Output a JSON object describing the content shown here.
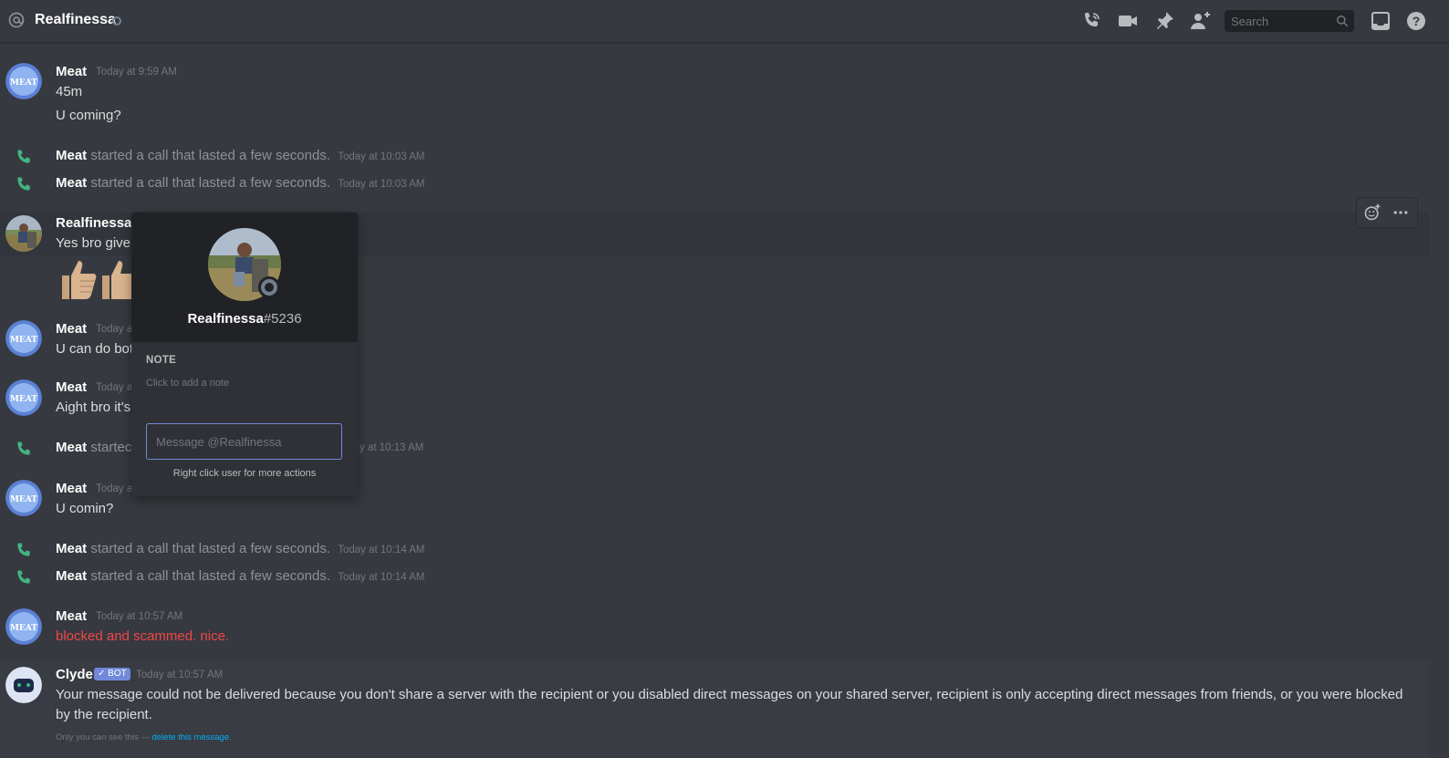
{
  "header": {
    "channel_name": "Realfinessa",
    "search_placeholder": "Search",
    "icons": [
      "at-icon",
      "phone-call-icon",
      "video-call-icon",
      "pin-icon",
      "add-friend-icon",
      "search-icon",
      "inbox-icon",
      "help-icon"
    ]
  },
  "messages": {
    "m1": {
      "author": "Meat",
      "timestamp": "Today at 9:59 AM",
      "lines": [
        "45m",
        "U coming?"
      ]
    },
    "c1": {
      "author": "Meat",
      "text": "started a call that lasted a few seconds.",
      "timestamp": "Today at 10:03 AM"
    },
    "c2": {
      "author": "Meat",
      "text": "started a call that lasted a few seconds.",
      "timestamp": "Today at 10:03 AM"
    },
    "m2": {
      "author": "Realfinessa",
      "line": "Yes bro give"
    },
    "m3": {
      "author": "Meat",
      "timestamp_partial": "Today a",
      "line": "U can do bot"
    },
    "m4": {
      "author": "Meat",
      "timestamp_partial": "Today a",
      "line": "Aight bro it's"
    },
    "c3": {
      "author": "Meat",
      "text_partial": "startec",
      "timestamp_partial": "y at 10:13 AM"
    },
    "m5": {
      "author": "Meat",
      "timestamp_partial": "Today a",
      "line": "U comin?"
    },
    "c4": {
      "author": "Meat",
      "text": "started a call that lasted a few seconds.",
      "timestamp": "Today at 10:14 AM"
    },
    "c5": {
      "author": "Meat",
      "text": "started a call that lasted a few seconds.",
      "timestamp": "Today at 10:14 AM"
    },
    "m6": {
      "author": "Meat",
      "timestamp": "Today at 10:57 AM",
      "line": "blocked and scammed. nice."
    },
    "clyde": {
      "author": "Clyde",
      "badge": "BOT",
      "timestamp": "Today at 10:57 AM",
      "line1": "Your message could not be delivered because you don't share a server with the recipient or you disabled direct messages on your shared server, recipient is only accepting direct messages from friends, or you were blocked",
      "line2": "by the recipient.",
      "only_you": "Only you can see this —",
      "delete_link": "delete this message."
    }
  },
  "popout": {
    "username": "Realfinessa",
    "discriminator": "#5236",
    "note_heading": "NOTE",
    "note_placeholder": "Click to add a note",
    "message_placeholder": "Message @Realfinessa",
    "hint": "Right click user for more actions"
  },
  "colors": {
    "accent": "#7289da",
    "call_green": "#43b581",
    "error_red": "#f04747",
    "link": "#00b0f4"
  }
}
